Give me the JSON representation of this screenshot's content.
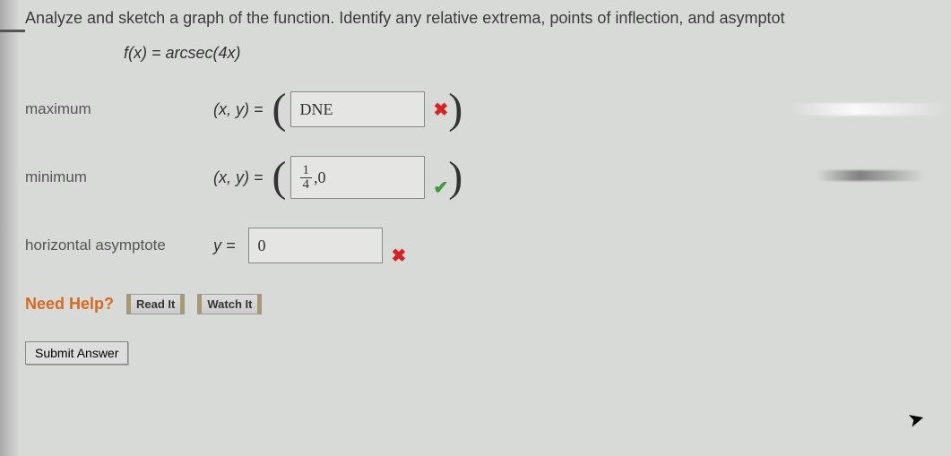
{
  "question": "Analyze and sketch a graph of the function. Identify any relative extrema, points of inflection, and asymptot",
  "formula": "f(x) = arcsec(4x)",
  "rows": {
    "maximum": {
      "label": "maximum",
      "prefix": "(x, y)  =",
      "lparen": "(",
      "value": "DNE",
      "rparen": ")",
      "mark": "✖",
      "mark_state": "wrong"
    },
    "minimum": {
      "label": "minimum",
      "prefix": "(x, y)  =",
      "lparen": "(",
      "frac_num": "1",
      "frac_den": "4",
      "after_frac": ",0",
      "rparen": ")",
      "mark": "✔",
      "mark_state": "right"
    },
    "asymptote": {
      "label": "horizontal asymptote",
      "prefix": "y  =",
      "value": "0",
      "mark": "✖",
      "mark_state": "wrong"
    }
  },
  "help": {
    "title": "Need Help?",
    "read": "Read It",
    "watch": "Watch It"
  },
  "submit": "Submit Answer"
}
